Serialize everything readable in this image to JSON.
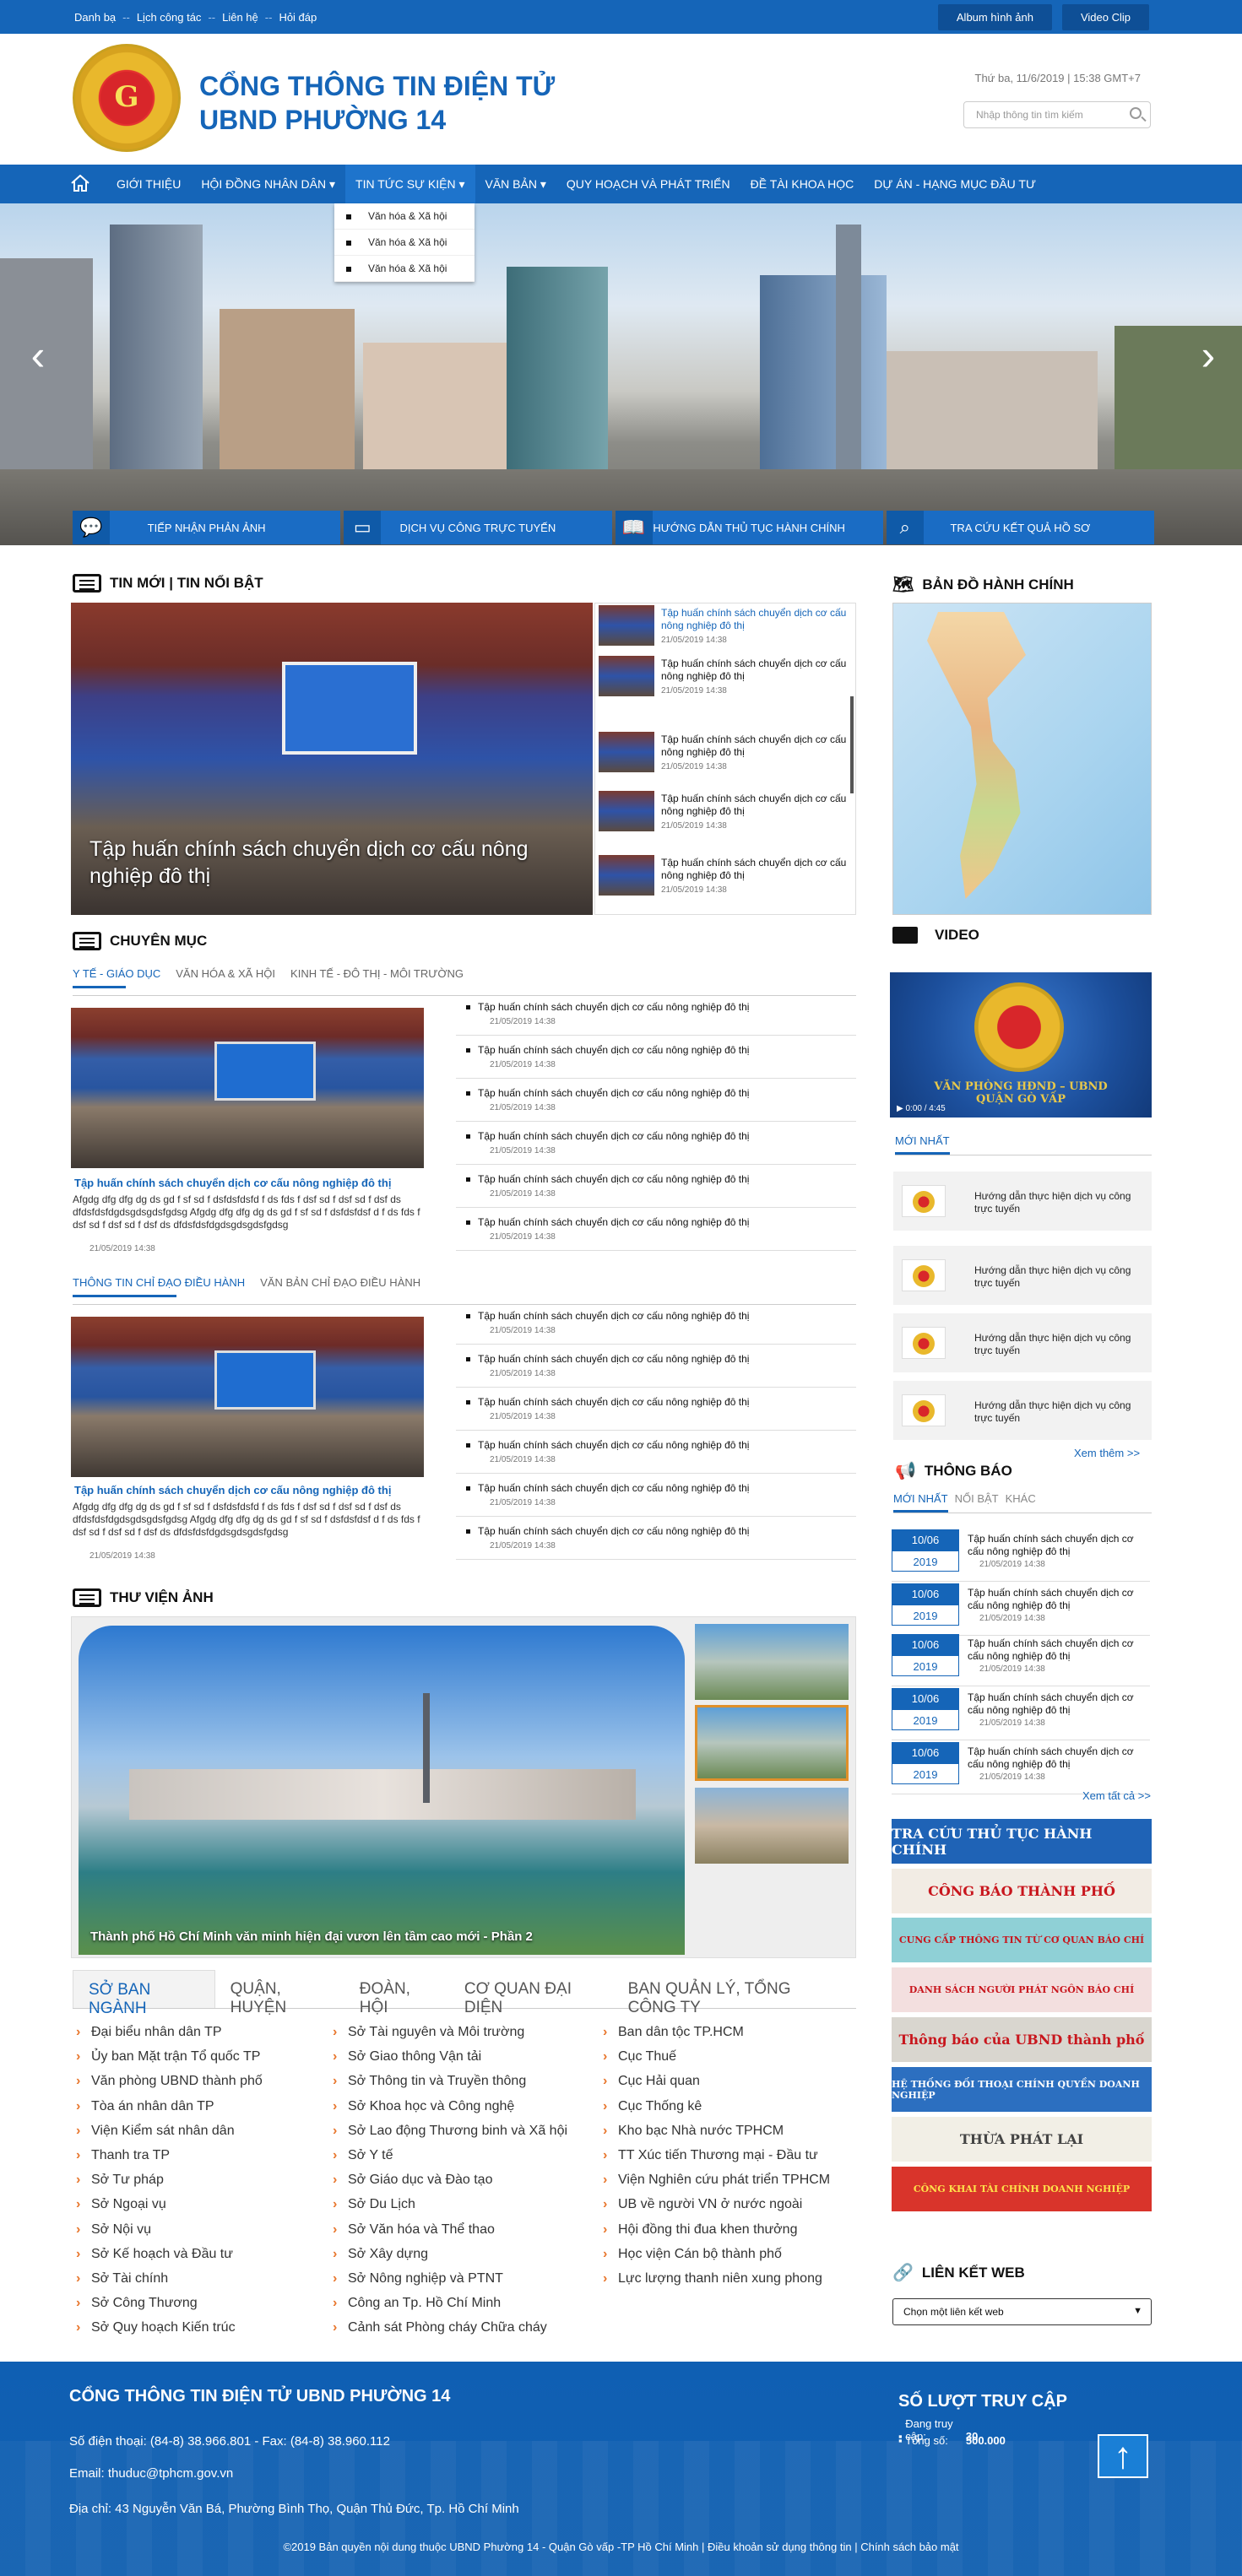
{
  "topbar": {
    "links": [
      "Danh bạ",
      "Lịch công tác",
      "Liên hệ",
      "Hỏi đáp"
    ],
    "album_label": "Album hình ảnh",
    "video_label": "Video Clip"
  },
  "header": {
    "title_line1": "CỔNG THÔNG TIN ĐIỆN TỬ",
    "title_line2": "UBND PHƯỜNG 14",
    "logo_letter": "G",
    "datetime": "Thứ ba, 11/6/2019 | 15:38 GMT+7",
    "search_placeholder": "Nhập thông tin tìm kiếm"
  },
  "nav": {
    "items": [
      "GIỚI THIỆU",
      "HỘI ĐỒNG NHÂN DÂN ▾",
      "TIN TỨC SỰ KIỆN ▾",
      "VĂN BẢN ▾",
      "QUY HOẠCH VÀ PHÁT TRIỂN",
      "ĐỀ TÀI KHOA HỌC",
      "DỰ ÁN - HẠNG MỤC ĐẦU TƯ"
    ],
    "dropdown": [
      "Văn hóa & Xã hội",
      "Văn hóa & Xã hội",
      "Văn hóa & Xã hội"
    ]
  },
  "services": [
    "TIẾP NHẬN PHẢN ẢNH",
    "DỊCH VỤ CÔNG TRỰC TUYẾN",
    "HƯỚNG DẪN THỦ TỤC HÀNH CHÍNH",
    "TRA CỨU KẾT QUẢ HỒ SƠ"
  ],
  "news": {
    "title": "TIN MỚI | TIN NỔI BẬT",
    "main_caption": "Tập huấn chính sách chuyển dịch cơ cấu nông nghiệp đô thị",
    "items": [
      {
        "title": "Tập huấn chính sách chuyển dịch cơ cấu nông nghiệp đô thị",
        "date": "21/05/2019 14:38"
      },
      {
        "title": "Tập huấn chính sách chuyển dịch cơ cấu nông nghiệp đô thị",
        "date": "21/05/2019 14:38"
      },
      {
        "title": "Tập huấn chính sách chuyển dịch cơ cấu nông nghiệp đô thị",
        "date": "21/05/2019 14:38"
      },
      {
        "title": "Tập huấn chính sách chuyển dịch cơ cấu nông nghiệp đô thị",
        "date": "21/05/2019 14:38"
      },
      {
        "title": "Tập huấn chính sách chuyển dịch cơ cấu nông nghiệp đô thị",
        "date": "21/05/2019 14:38"
      }
    ]
  },
  "categories": {
    "title": "CHUYÊN MỤC",
    "tabs1": [
      "Y TẾ - GIÁO DỤC",
      "VĂN HÓA & XÃ HỘI",
      "KINH TẾ - ĐÔ THỊ - MÔI TRƯỜNG"
    ],
    "tabs2": [
      "THÔNG TIN CHỈ ĐẠO ĐIỀU HÀNH",
      "VĂN BẢN CHỈ ĐẠO ĐIỀU HÀNH"
    ],
    "feature_title": "Tập huấn chính sách chuyển dịch cơ cấu nông nghiệp đô thị",
    "feature_desc": "Afgdg dfg dfg  dg ds gd f sf sd f dsfdsfdsfd f ds fds f dsf sd f dsf sd f dsf ds dfdsfdsfdgdsgdsgdsfgdsg Afgdg dfg dfg  dg ds gd f sf sd f dsfdsfdsf d f ds fds f dsf sd f dsf sd f dsf ds dfdsfdsfdgdsgdsgdsfgdsg",
    "feature_date": "21/05/2019 14:38",
    "item_title": "Tập huấn chính sách chuyển dịch cơ cấu nông nghiệp đô thị",
    "item_date": "21/05/2019 14:38"
  },
  "gallery": {
    "title": "THƯ VIỆN ẢNH",
    "caption": "Thành phố Hồ Chí Minh văn minh hiện đại vươn lên tầm cao mới - Phần 2"
  },
  "departments": {
    "tabs": [
      "SỞ BAN NGÀNH",
      "QUẬN, HUYỆN",
      "ĐOÀN, HỘI",
      "CƠ QUAN ĐẠI DIỆN",
      "BAN QUẢN LÝ, TỔNG CÔNG TY"
    ],
    "col1": [
      "Đại biểu nhân dân TP",
      "Ủy ban Mặt trận Tổ quốc TP",
      "Văn phòng UBND thành phố",
      "Tòa án nhân dân TP",
      "Viện Kiểm sát nhân dân",
      "Thanh tra TP",
      "Sở Tư pháp",
      "Sở Ngoại vụ",
      "Sở Nội vụ",
      "Sở Kế hoạch và Đầu tư",
      "Sở Tài chính",
      "Sở Công Thương",
      "Sở Quy hoạch Kiến trúc"
    ],
    "col2": [
      "Sở Tài nguyên và Môi trường",
      "Sở Giao thông Vận tải",
      "Sở Thông tin và Truyền thông",
      "Sở Khoa học và Công nghệ",
      "Sở Lao động Thương binh và Xã hội",
      "Sở Y tế",
      "Sở Giáo dục và Đào tạo",
      "Sở Du Lịch",
      "Sở Văn hóa và Thể thao",
      "Sở Xây dựng",
      "Sở Nông nghiệp và PTNT",
      "Công an Tp. Hồ Chí Minh",
      "Cảnh sát Phòng cháy Chữa cháy"
    ],
    "col3": [
      "Ban dân tộc TP.HCM",
      "Cục Thuế",
      "Cục Hải quan",
      "Cục Thống kê",
      "Kho bạc Nhà nước TPHCM",
      "TT Xúc tiến Thương mại - Đầu tư",
      "Viện Nghiên cứu phát triển TPHCM",
      "UB về người VN ở nước ngoài",
      "Hội đồng thi đua khen thưởng",
      "Học viện Cán bộ thành phố",
      "Lực lượng thanh niên xung phong"
    ]
  },
  "sidebar": {
    "map_title": "BẢN ĐỒ HÀNH CHÍNH",
    "video_title": "VIDEO",
    "video_text": "VĂN PHÒNG HĐND – UBND",
    "video_text2": "QUẬN GÒ VẤP",
    "video_time": "0:00 / 4:45",
    "video_tab": "MỚI NHẤT",
    "video_items": [
      "Hướng dẫn thực hiện dịch vụ công trực tuyến",
      "Hướng dẫn thực hiện dịch vụ công trực tuyến",
      "Hướng dẫn thực hiện dịch vụ công trực tuyến",
      "Hướng dẫn thực hiện dịch vụ công trực tuyến"
    ],
    "video_more": "Xem thêm >>",
    "notice_title": "THÔNG BÁO",
    "notice_tabs": [
      "MỚI NHẤT",
      "NỔI BẬT",
      "KHÁC"
    ],
    "notice_items": [
      {
        "day": "10/06",
        "year": "2019",
        "title": "Tập huấn chính sách chuyển dịch cơ cấu nông nghiệp đô thị",
        "date": "21/05/2019 14:38"
      },
      {
        "day": "10/06",
        "year": "2019",
        "title": "Tập huấn chính sách chuyển dịch cơ cấu nông nghiệp đô thị",
        "date": "21/05/2019 14:38"
      },
      {
        "day": "10/06",
        "year": "2019",
        "title": "Tập huấn chính sách chuyển dịch cơ cấu nông nghiệp đô thị",
        "date": "21/05/2019 14:38"
      },
      {
        "day": "10/06",
        "year": "2019",
        "title": "Tập huấn chính sách chuyển dịch cơ cấu nông nghiệp đô thị",
        "date": "21/05/2019 14:38"
      },
      {
        "day": "10/06",
        "year": "2019",
        "title": "Tập huấn chính sách chuyển dịch cơ cấu nông nghiệp đô thị",
        "date": "21/05/2019 14:38"
      }
    ],
    "notice_more": "Xem tất cả >>",
    "banners": [
      {
        "text": "TRA CỨU THỦ TỤC HÀNH CHÍNH",
        "color": "#1f63b6",
        "fg": "#ffffff"
      },
      {
        "text": "CÔNG BÁO THÀNH PHỐ",
        "color": "#f2ece4",
        "fg": "#c8161d"
      },
      {
        "text": "CUNG CẤP THÔNG TIN TỪ CƠ QUAN BÁO CHÍ",
        "color": "#8fd0d6",
        "fg": "#c8161d"
      },
      {
        "text": "DANH SÁCH NGƯỜI PHÁT NGÔN BÁO CHÍ",
        "color": "#f3dfdf",
        "fg": "#c8161d"
      },
      {
        "text": "Thông báo của UBND thành phố",
        "color": "#d9d6cf",
        "fg": "#c8161d"
      },
      {
        "text": "HỆ THỐNG ĐỐI THOẠI CHÍNH QUYỀN DOANH NGHIỆP",
        "color": "#2c6fc0",
        "fg": "#ffffff"
      },
      {
        "text": "THỪA PHÁT LẠI",
        "color": "#f2efe6",
        "fg": "#444444"
      },
      {
        "text": "CÔNG KHAI TÀI CHÍNH DOANH NGHIỆP",
        "color": "#d9342b",
        "fg": "#ffe24a"
      }
    ],
    "link_title": "LIÊN KẾT WEB",
    "link_select": "Chọn một liên kết web"
  },
  "footer": {
    "title": "CỔNG THÔNG TIN ĐIỆN TỬ UBND PHƯỜNG 14",
    "phone": "Số điện thoại: (84-8) 38.966.801 - Fax: (84-8) 38.960.112",
    "email": "Email: thuduc@tphcm.gov.vn",
    "address": "Địa chỉ: 43 Nguyễn Văn Bá, Phường Bình Thọ, Quận Thủ Đức, Tp. Hồ Chí Minh",
    "counter_title": "SỐ LƯỢT TRUY CẬP",
    "online_label": "Đang truy cập:",
    "online_value": "30",
    "total_label": "Tổng số:",
    "total_value": "500.000",
    "copyright": "©2019 Bản quyền nội dung thuộc UBND Phường 14 - Quận Gò vấp -TP Hồ Chí Minh | Điều khoản sử dụng thông tin | Chính sách bảo mật"
  }
}
